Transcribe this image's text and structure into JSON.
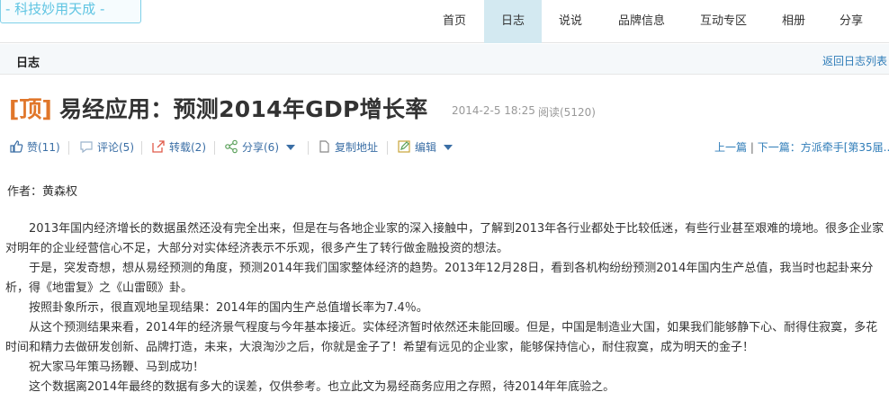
{
  "brand": {
    "logo_text": "- 科技妙用天成 -"
  },
  "nav": {
    "items": [
      {
        "label": "首页"
      },
      {
        "label": "日志"
      },
      {
        "label": "说说"
      },
      {
        "label": "品牌信息"
      },
      {
        "label": "互动专区"
      },
      {
        "label": "相册"
      },
      {
        "label": "分享"
      }
    ],
    "active": "日志"
  },
  "subbar": {
    "title": "日志",
    "back_link": "返回日志列表"
  },
  "post": {
    "tag": "[顶]",
    "title": "易经应用：预测2014年GDP增长率",
    "date": "2014-2-5 18:25",
    "reads": "阅读(5120)"
  },
  "actions": {
    "like": "赞(11)",
    "comment": "评论(5)",
    "repost": "转载(2)",
    "share": "分享(6)",
    "copy": "复制地址",
    "edit": "编辑"
  },
  "pager": {
    "prev": "上一篇",
    "separator": "|",
    "next": "下一篇：方派牵手[第35届..."
  },
  "author_line": "作者：黄森权",
  "paragraphs": [
    "　　2013年国内经济增长的数据虽然还没有完全出来，但是在与各地企业家的深入接触中，了解到2013年各行业都处于比较低迷，有些行业甚至艰难的境地。很多企业家对明年的企业经营信心不足，大部分对实体经济表示不乐观，很多产生了转行做金融投资的想法。",
    "　　于是，突发奇想，想从易经预测的角度，预测2014年我们国家整体经济的趋势。2013年12月28日，看到各机构纷纷预测2014年国内生产总值，我当时也起卦来分析，得《地雷复》之《山雷颐》卦。",
    "　　按照卦象所示，很直观地呈现结果：2014年的国内生产总值增长率为7.4％。",
    "　　从这个预测结果来看，2014年的经济景气程度与今年基本接近。实体经济暂时依然还未能回暖。但是，中国是制造业大国，如果我们能够静下心、耐得住寂寞，多花时间和精力去做研发创新、品牌打造，未来，大浪淘沙之后，你就是金子了！希望有远见的企业家，能够保持信心，耐住寂寞，成为明天的金子！",
    "　　祝大家马年策马扬鞭、马到成功！",
    "　　这个数据离2014年最终的数据有多大的误差，仅供参考。也立此文为易经商务应用之存照，待2014年年底验之。"
  ],
  "colors": {
    "accent_blue": "#3a6ea5",
    "link_blue": "#2e7cb8",
    "tag_orange": "#e0762a",
    "active_nav_bg": "#d3e9f1"
  }
}
